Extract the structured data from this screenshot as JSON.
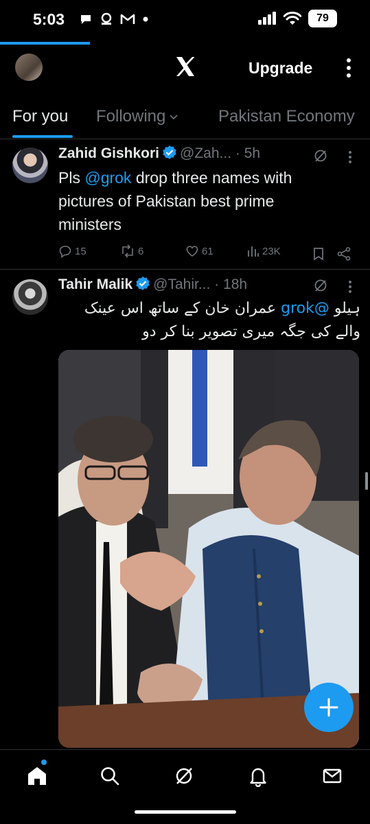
{
  "status_bar": {
    "time": "5:03",
    "battery": "79",
    "icons": [
      "chat-bubble-icon",
      "email-outline-icon",
      "gmail-icon",
      "dot-icon",
      "signal-icon",
      "wifi-icon",
      "battery-icon"
    ]
  },
  "header": {
    "logo": "x-logo-icon",
    "upgrade_label": "Upgrade",
    "more_icon": "vertical-ellipsis-icon"
  },
  "tabs": [
    {
      "label": "For you",
      "active": true
    },
    {
      "label": "Following",
      "has_dropdown": true
    },
    {
      "label": "Pakistan Economy"
    }
  ],
  "posts": [
    {
      "name": "Zahid Gishkori",
      "handle": "@Zah...",
      "time": "5h",
      "text_parts": {
        "pre": "Pls ",
        "mention": "@grok",
        "post": " drop three names with pictures of Pakistan best prime ministers"
      },
      "stats": {
        "replies": "15",
        "reposts": "6",
        "likes": "61",
        "views": "23K"
      }
    },
    {
      "name": "Tahir Malik",
      "handle": "@Tahir...",
      "time": "18h",
      "text_parts": {
        "pre": "ہیلو ",
        "mention": "@grok",
        "post": " عمران خان کے ساتھ اس عینک والے کی جگہ میری تصویر بنا کر دو"
      }
    }
  ],
  "colors": {
    "accent": "#1d9bf0",
    "background": "#000000",
    "text": "#e7e9ea",
    "muted": "#71767b",
    "divider": "#2f3336"
  },
  "bottom_nav": [
    "home-icon",
    "search-icon",
    "grok-icon",
    "notifications-icon",
    "messages-icon"
  ],
  "fab_icon": "plus-icon"
}
